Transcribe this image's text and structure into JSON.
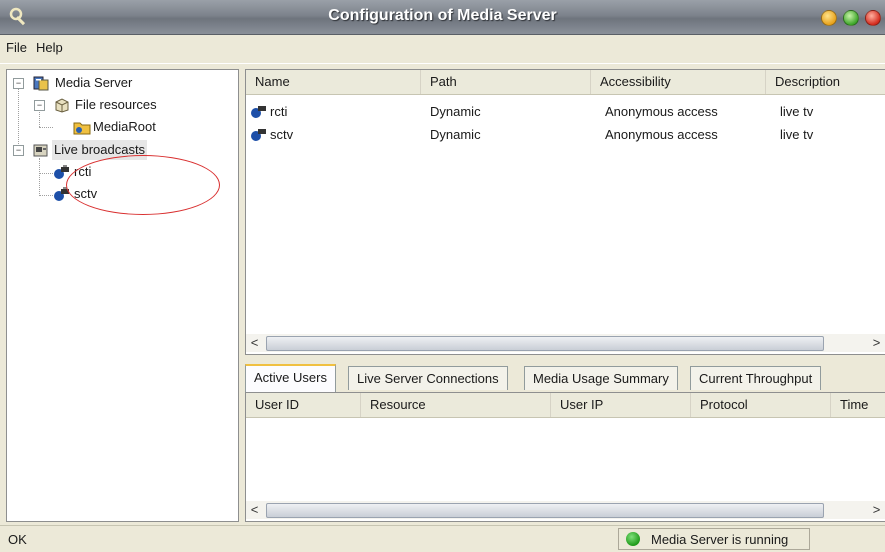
{
  "window": {
    "title": "Configuration of Media Server"
  },
  "menu": {
    "items": [
      "File",
      "Help"
    ]
  },
  "tree": {
    "root": "Media Server",
    "file_resources": "File resources",
    "media_root": "MediaRoot",
    "live_broadcasts": "Live broadcasts",
    "streams": [
      "rcti",
      "sctv"
    ]
  },
  "resources": {
    "columns": [
      "Name",
      "Path",
      "Accessibility",
      "Description"
    ],
    "rows": [
      {
        "name": "rcti",
        "path": "Dynamic",
        "accessibility": "Anonymous access",
        "description": "live tv"
      },
      {
        "name": "sctv",
        "path": "Dynamic",
        "accessibility": "Anonymous access",
        "description": "live tv"
      }
    ]
  },
  "tabs": [
    "Active Users",
    "Live Server Connections",
    "Media Usage Summary",
    "Current Throughput"
  ],
  "users": {
    "columns": [
      "User ID",
      "Resource",
      "User IP",
      "Protocol",
      "Time"
    ]
  },
  "status": {
    "text": "OK",
    "server_state": "Media Server is running"
  },
  "colors": {
    "running_indicator": "#1f9a1a",
    "annotation": "#d93030"
  }
}
